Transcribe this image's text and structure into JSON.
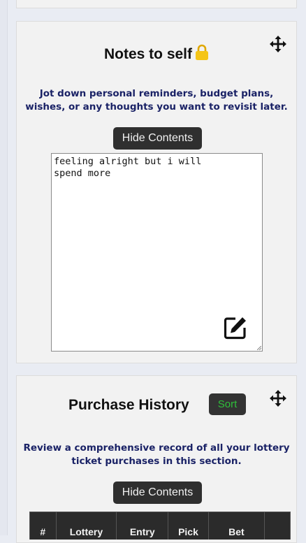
{
  "notes": {
    "title": "Notes to self",
    "description": "Jot down personal reminders, budget plans, wishes, or any thoughts you want to revisit later.",
    "hide_button": "Hide Contents",
    "text": "feeling alright but i will\nspend more",
    "icons": {
      "move": "move-arrows-icon",
      "lock": "lock-icon",
      "edit": "edit-pen-icon"
    },
    "lock_color": "#f5c518"
  },
  "history": {
    "title": "Purchase History",
    "sort_button": "Sort",
    "description": "Review a comprehensive record of all your lottery ticket purchases in this section.",
    "hide_button": "Hide Contents",
    "columns": [
      "#",
      "Lottery",
      "Entry",
      "Pick",
      "Bet",
      ""
    ],
    "icons": {
      "move": "move-arrows-icon"
    },
    "sort_color": "#2fbf3a"
  }
}
